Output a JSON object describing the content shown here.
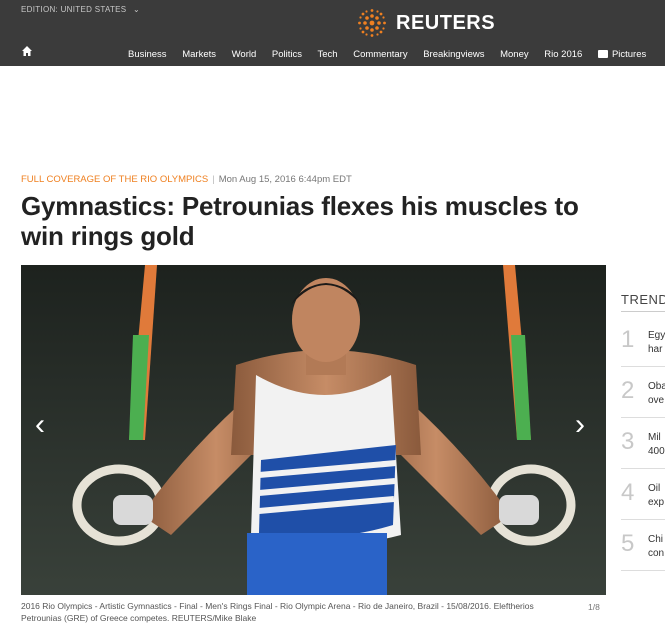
{
  "header": {
    "edition_label": "EDITION:",
    "edition_value": "UNITED STATES",
    "brand": "REUTERS",
    "nav": [
      "Business",
      "Markets",
      "World",
      "Politics",
      "Tech",
      "Commentary",
      "Breakingviews",
      "Money",
      "Rio 2016",
      "Pictures"
    ]
  },
  "article": {
    "kicker": "FULL COVERAGE OF THE RIO OLYMPICS",
    "separator": "|",
    "date": "Mon Aug 15, 2016 6:44pm EDT",
    "headline": "Gymnastics: Petrounias flexes his muscles to win rings gold",
    "caption": "2016 Rio Olympics - Artistic Gymnastics - Final - Men's Rings Final - Rio Olympic Arena - Rio de Janeiro, Brazil - 15/08/2016. Eleftherios Petrounias (GRE) of Greece competes. REUTERS/Mike Blake",
    "slide_counter": "1/8"
  },
  "trending": {
    "title": "TRENDING",
    "items": [
      {
        "num": "1",
        "line1": "Egy",
        "line2": "har"
      },
      {
        "num": "2",
        "line1": "Oba",
        "line2": "ove"
      },
      {
        "num": "3",
        "line1": "Mil",
        "line2": "400"
      },
      {
        "num": "4",
        "line1": "Oil",
        "line2": "exp"
      },
      {
        "num": "5",
        "line1": "Chi",
        "line2": "con"
      }
    ]
  },
  "colors": {
    "topbar": "#3b3b3b",
    "accent": "#ef8021"
  },
  "icons": [
    "chevron-down-icon",
    "reuters-logo-icon",
    "home-icon",
    "camera-icon",
    "chevron-left-icon",
    "chevron-right-icon"
  ]
}
